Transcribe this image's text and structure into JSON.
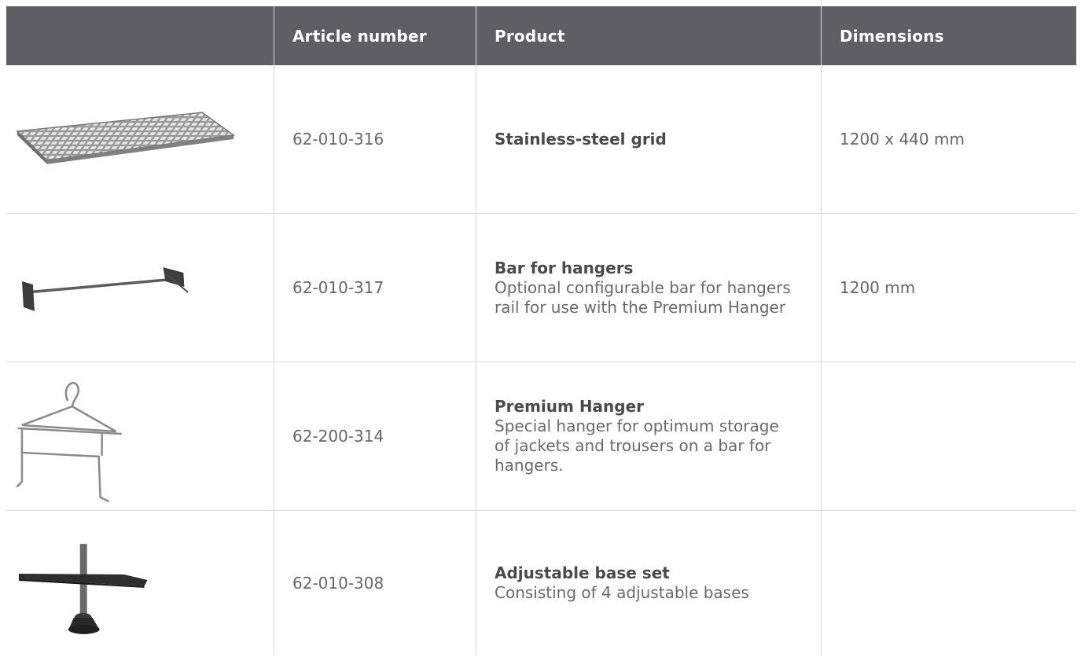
{
  "header": {
    "col_image": "",
    "col_article": "Article number",
    "col_product": "Product",
    "col_dimensions": "Dimensions"
  },
  "rows": [
    {
      "image_icon": "stainless-steel-grid-image",
      "article": "62-010-316",
      "name": "Stainless-steel grid",
      "description": "",
      "dimensions": "1200 x 440 mm"
    },
    {
      "image_icon": "hanger-bar-image",
      "article": "62-010-317",
      "name": "Bar for hangers",
      "description": "Optional configurable bar for hangers\nrail for use with the Premium Hanger",
      "dimensions": "1200 mm"
    },
    {
      "image_icon": "premium-hanger-image",
      "article": "62-200-314",
      "name": "Premium Hanger",
      "description": "Special hanger for optimum storage\nof jackets and trousers on a bar for\nhangers.",
      "dimensions": ""
    },
    {
      "image_icon": "adjustable-base-image",
      "article": "62-010-308",
      "name": "Adjustable base set",
      "description": "Consisting of 4 adjustable bases",
      "dimensions": ""
    }
  ],
  "colors": {
    "header_bg": "#5f5f61",
    "header_text": "#ffffff",
    "border": "#d9d9d9",
    "body_text": "#666666"
  }
}
